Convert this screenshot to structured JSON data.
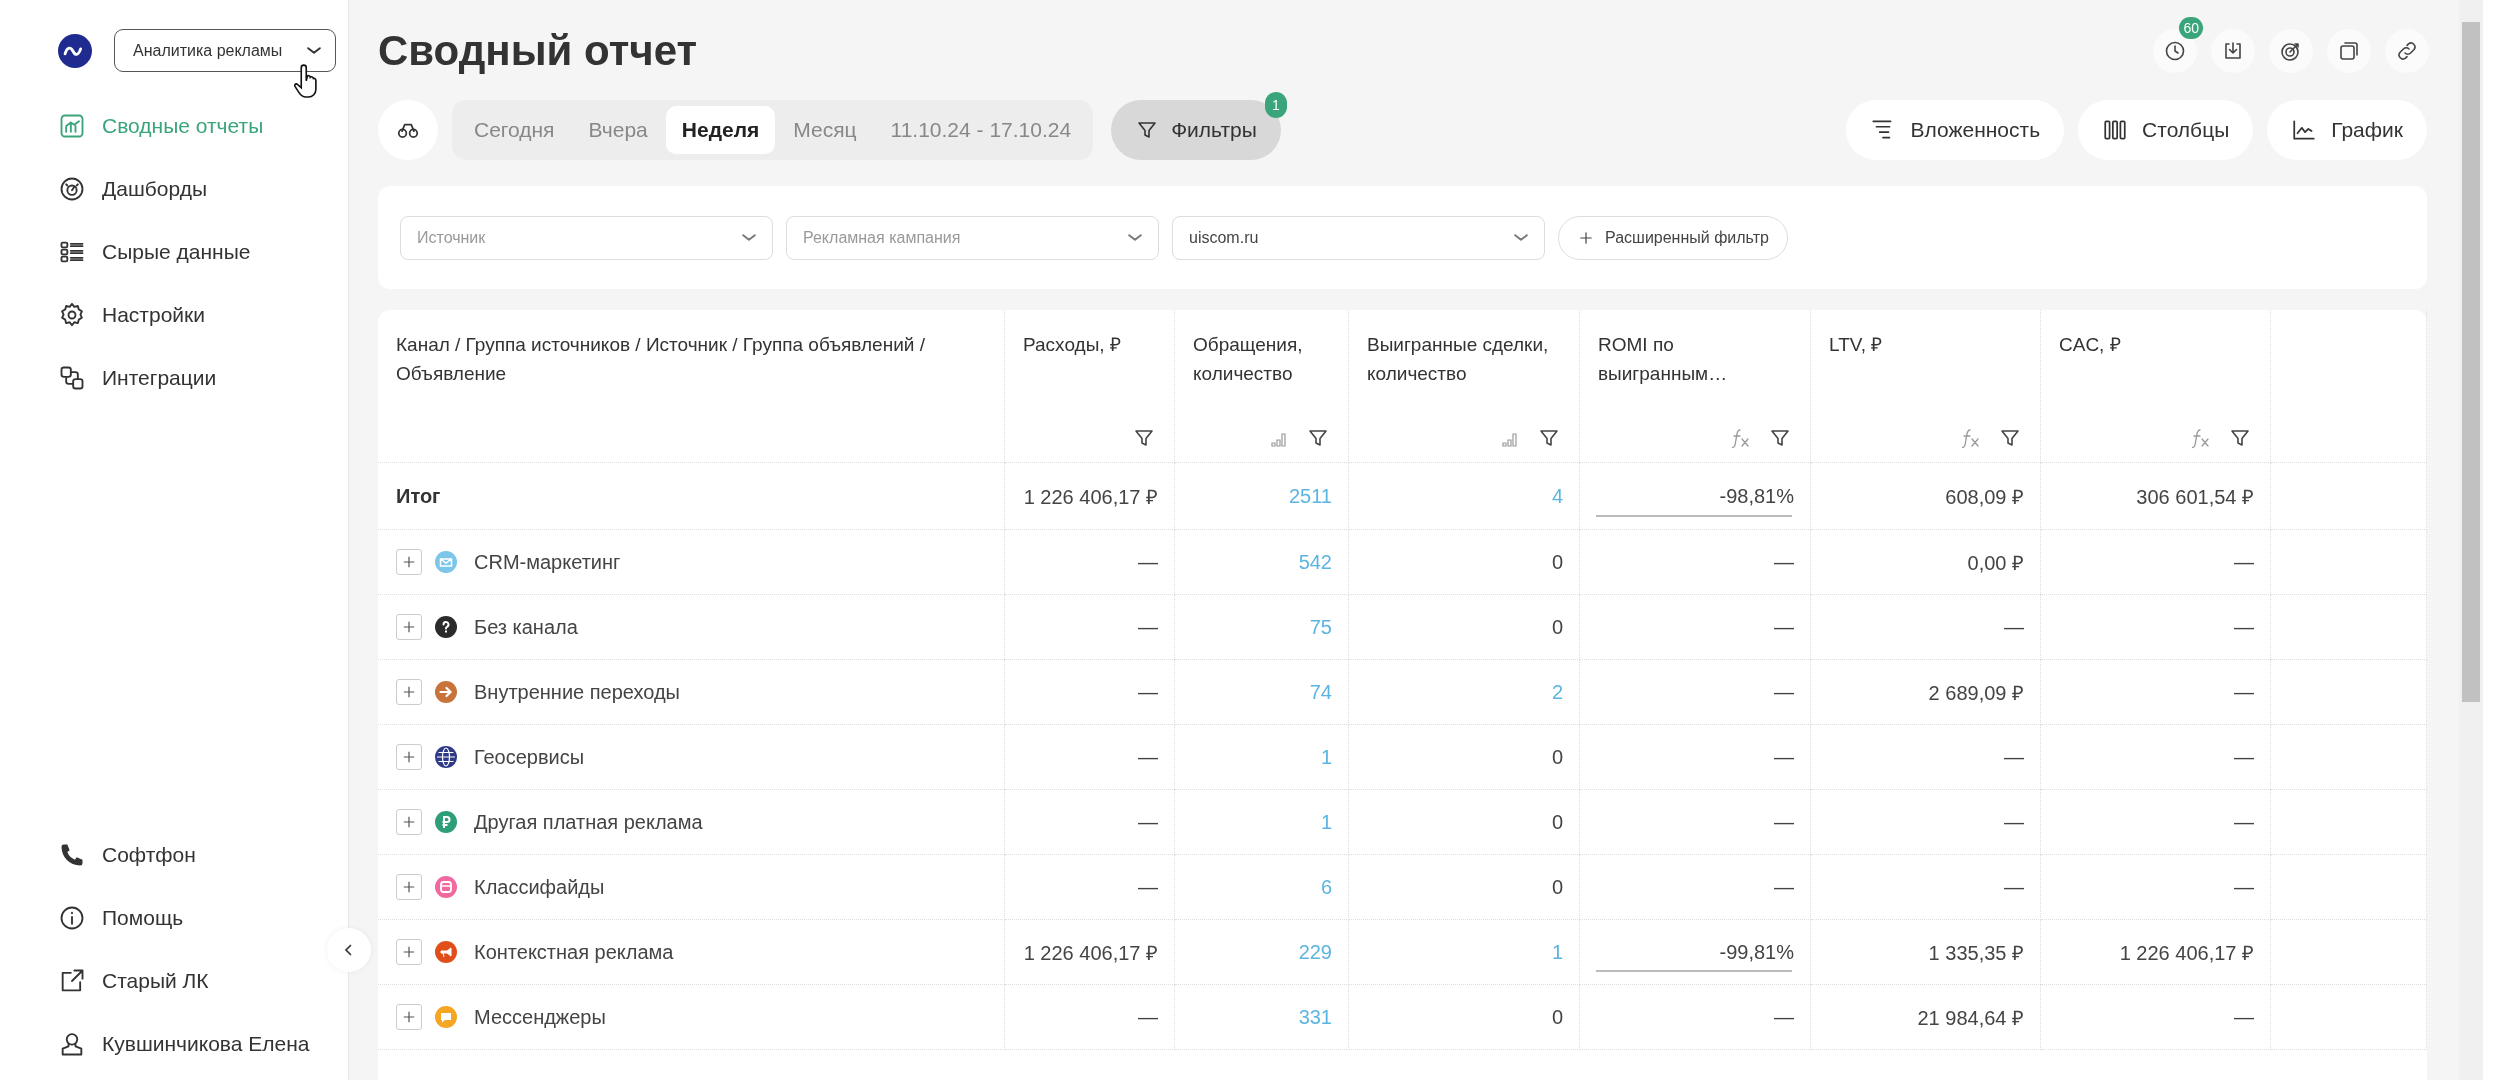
{
  "sidebar": {
    "product_select": {
      "value": "Аналитика рекламы"
    },
    "nav": [
      {
        "label": "Сводные отчеты",
        "kind": "report",
        "selected": true
      },
      {
        "label": "Дашборды",
        "kind": "dashboard",
        "selected": false
      },
      {
        "label": "Сырые данные",
        "kind": "raw",
        "selected": false
      },
      {
        "label": "Настройки",
        "kind": "settings",
        "selected": false
      },
      {
        "label": "Интеграции",
        "kind": "integrations",
        "selected": false
      }
    ],
    "footer_nav": [
      {
        "label": "Софтфон",
        "kind": "phone"
      },
      {
        "label": "Помощь",
        "kind": "info"
      },
      {
        "label": "Старый ЛК",
        "kind": "external"
      },
      {
        "label": "Кувшинчикова Елена",
        "kind": "user"
      }
    ]
  },
  "header": {
    "title": "Сводный отчет",
    "history_badge": "60"
  },
  "periods": [
    {
      "label": "Сегодня",
      "selected": false
    },
    {
      "label": "Вчера",
      "selected": false
    },
    {
      "label": "Неделя",
      "selected": true
    },
    {
      "label": "Месяц",
      "selected": false
    },
    {
      "label": "11.10.24 - 17.10.24",
      "selected": false
    }
  ],
  "filters_button": {
    "label": "Фильтры",
    "badge": "1"
  },
  "view_buttons": [
    {
      "label": "Вложенность",
      "kind": "nesting"
    },
    {
      "label": "Столбцы",
      "kind": "columns"
    },
    {
      "label": "График",
      "kind": "chart"
    }
  ],
  "filter_fields": [
    {
      "placeholder": "Источник"
    },
    {
      "placeholder": "Рекламная кампания"
    },
    {
      "value": "uiscom.ru"
    }
  ],
  "advanced_filter": "Расширенный фильтр",
  "table": {
    "columns": [
      {
        "label": "Канал / Группа источников / Источник / Группа объявлений / Объявление",
        "kind": "label"
      },
      {
        "label": "Расходы, ₽",
        "kind": "filter"
      },
      {
        "label": "Обращения, количество",
        "kind": "bars"
      },
      {
        "label": "Выигранные сделки, количество",
        "kind": "bars"
      },
      {
        "label": "ROMI по выигранным…",
        "kind": "fx"
      },
      {
        "label": "LTV, ₽",
        "kind": "fx"
      },
      {
        "label": "CAC, ₽",
        "kind": "fx"
      }
    ],
    "total": {
      "label": "Итог",
      "romi_bar": true,
      "cells": [
        {
          "text": "1 226 406,17 ₽",
          "link": false
        },
        {
          "text": "2511",
          "link": true
        },
        {
          "text": "4",
          "link": true
        },
        {
          "text": "-98,81%",
          "link": false
        },
        {
          "text": "608,09 ₽",
          "link": false
        },
        {
          "text": "306 601,54 ₽",
          "link": false
        }
      ]
    },
    "rows": [
      {
        "name": "CRM-маркетинг",
        "kind": "mail",
        "color": "#7cc6ea",
        "romi_bar": false,
        "cells": [
          {
            "text": "—",
            "link": false
          },
          {
            "text": "542",
            "link": true
          },
          {
            "text": "0",
            "link": false
          },
          {
            "text": "—",
            "link": false
          },
          {
            "text": "0,00 ₽",
            "link": false
          },
          {
            "text": "—",
            "link": false
          }
        ]
      },
      {
        "name": "Без канала",
        "kind": "question",
        "color": "#2b2b2b",
        "romi_bar": false,
        "cells": [
          {
            "text": "—",
            "link": false
          },
          {
            "text": "75",
            "link": true
          },
          {
            "text": "0",
            "link": false
          },
          {
            "text": "—",
            "link": false
          },
          {
            "text": "—",
            "link": false
          },
          {
            "text": "—",
            "link": false
          }
        ]
      },
      {
        "name": "Внутренние переходы",
        "kind": "arrow",
        "color": "#c8733a",
        "romi_bar": false,
        "cells": [
          {
            "text": "—",
            "link": false
          },
          {
            "text": "74",
            "link": true
          },
          {
            "text": "2",
            "link": true
          },
          {
            "text": "—",
            "link": false
          },
          {
            "text": "2 689,09 ₽",
            "link": false
          },
          {
            "text": "—",
            "link": false
          }
        ]
      },
      {
        "name": "Геосервисы",
        "kind": "globe",
        "color": "#2e3a87",
        "romi_bar": false,
        "cells": [
          {
            "text": "—",
            "link": false
          },
          {
            "text": "1",
            "link": true
          },
          {
            "text": "0",
            "link": false
          },
          {
            "text": "—",
            "link": false
          },
          {
            "text": "—",
            "link": false
          },
          {
            "text": "—",
            "link": false
          }
        ]
      },
      {
        "name": "Другая платная реклама",
        "kind": "ruble",
        "color": "#2e9e7a",
        "romi_bar": false,
        "cells": [
          {
            "text": "—",
            "link": false
          },
          {
            "text": "1",
            "link": true
          },
          {
            "text": "0",
            "link": false
          },
          {
            "text": "—",
            "link": false
          },
          {
            "text": "—",
            "link": false
          },
          {
            "text": "—",
            "link": false
          }
        ]
      },
      {
        "name": "Классифайды",
        "kind": "board",
        "color": "#f06aa0",
        "romi_bar": false,
        "cells": [
          {
            "text": "—",
            "link": false
          },
          {
            "text": "6",
            "link": true
          },
          {
            "text": "0",
            "link": false
          },
          {
            "text": "—",
            "link": false
          },
          {
            "text": "—",
            "link": false
          },
          {
            "text": "—",
            "link": false
          }
        ]
      },
      {
        "name": "Контекстная реклама",
        "kind": "target",
        "color": "#e04e1a",
        "romi_bar": true,
        "cells": [
          {
            "text": "1 226 406,17 ₽",
            "link": false
          },
          {
            "text": "229",
            "link": true
          },
          {
            "text": "1",
            "link": true
          },
          {
            "text": "-99,81%",
            "link": false
          },
          {
            "text": "1 335,35 ₽",
            "link": false
          },
          {
            "text": "1 226 406,17 ₽",
            "link": false
          }
        ]
      },
      {
        "name": "Мессенджеры",
        "kind": "chat",
        "color": "#f5a623",
        "romi_bar": false,
        "cells": [
          {
            "text": "—",
            "link": false
          },
          {
            "text": "331",
            "link": true
          },
          {
            "text": "0",
            "link": false
          },
          {
            "text": "—",
            "link": false
          },
          {
            "text": "21 984,64 ₽",
            "link": false
          },
          {
            "text": "—",
            "link": false
          }
        ]
      }
    ]
  }
}
